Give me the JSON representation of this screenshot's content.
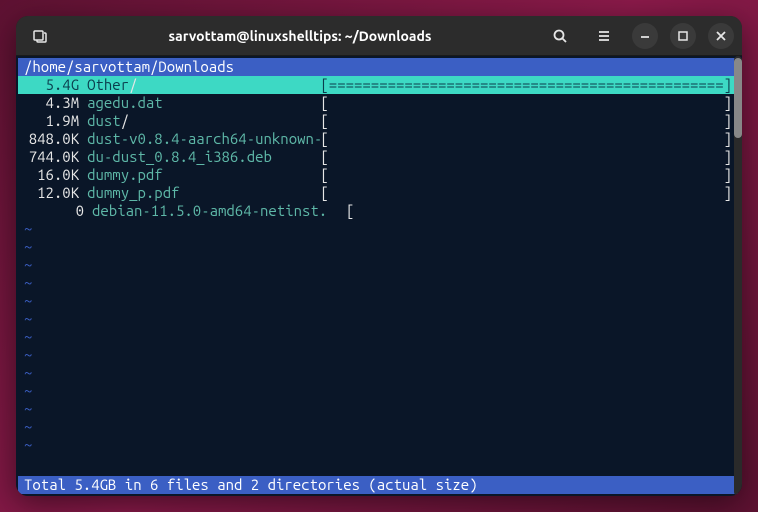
{
  "window": {
    "title": "sarvottam@linuxshelltips: ~/Downloads"
  },
  "terminal": {
    "path": "/home/sarvottam/Downloads",
    "files": [
      {
        "size": "5.4G",
        "name": "Other",
        "slash": "/",
        "bar": "[===============================================]",
        "selected": true
      },
      {
        "size": "4.3M",
        "name": "agedu.dat",
        "slash": "",
        "bar": "[                                               ]",
        "selected": false
      },
      {
        "size": "1.9M",
        "name": "dust",
        "slash": "/",
        "bar": "[                                               ]",
        "selected": false
      },
      {
        "size": "848.0K",
        "name": "dust-v0.8.4-aarch64-unknown-",
        "slash": "",
        "bar": "[                                               ]",
        "selected": false
      },
      {
        "size": "744.0K",
        "name": "du-dust_0.8.4_i386.deb",
        "slash": "",
        "bar": "[                                               ]",
        "selected": false
      },
      {
        "size": "16.0K",
        "name": "dummy.pdf",
        "slash": "",
        "bar": "[                                               ]",
        "selected": false
      },
      {
        "size": "12.0K",
        "name": "dummy_p.pdf",
        "slash": "",
        "bar": "[                                               ]",
        "selected": false
      },
      {
        "size": "0",
        "name": "debian-11.5.0-amd64-netinst.",
        "slash": "",
        "bar": "[",
        "selected": false
      }
    ],
    "status": "Total 5.4GB in 6 files and 2 directories (actual size)",
    "tilde": "~"
  }
}
